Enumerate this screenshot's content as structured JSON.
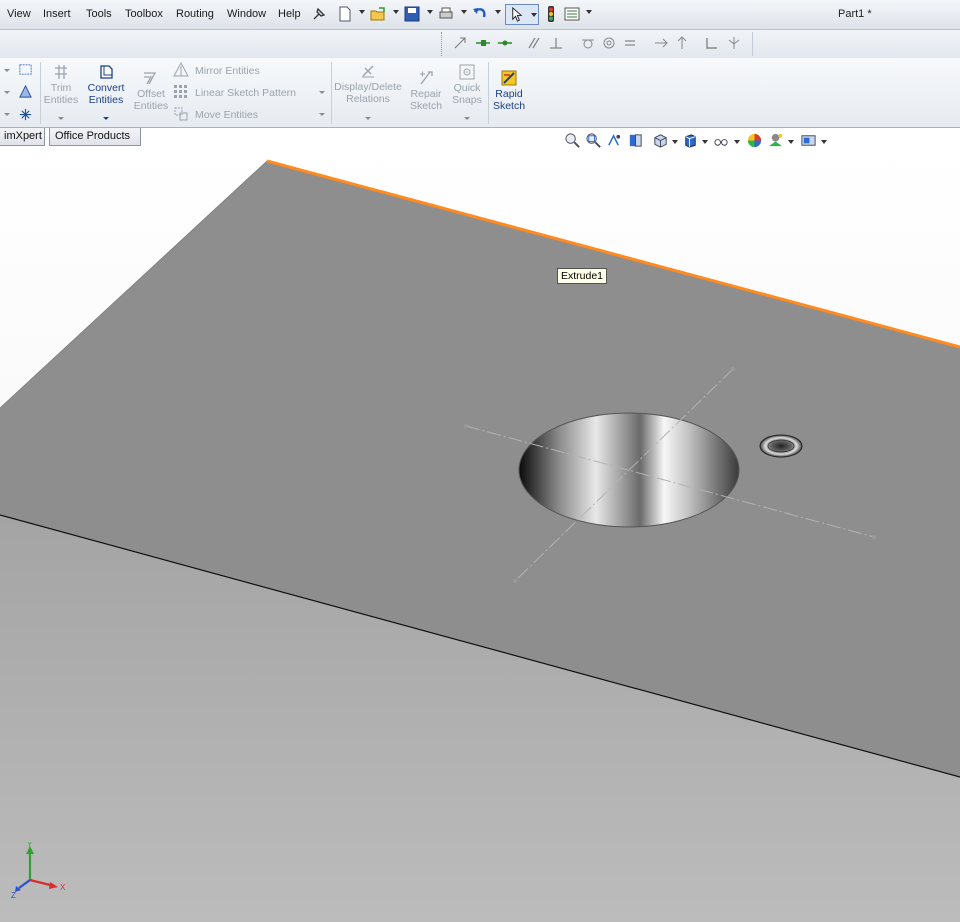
{
  "menu": {
    "items": [
      "View",
      "Insert",
      "Tools",
      "Toolbox",
      "Routing",
      "Window",
      "Help"
    ]
  },
  "document": {
    "title": "Part1 *"
  },
  "ribbon": {
    "trim": "Trim\nEntities",
    "convert": "Convert\nEntities",
    "offset": "Offset\nEntities",
    "mirror": "Mirror Entities",
    "linear_pattern": "Linear Sketch Pattern",
    "move": "Move Entities",
    "display_delete": "Display/Delete\nRelations",
    "repair": "Repair\nSketch",
    "quick_snaps": "Quick\nSnaps",
    "rapid_sketch": "Rapid\nSketch"
  },
  "tabs": [
    "imXpert",
    "Office Products"
  ],
  "viewport": {
    "tooltip": "Extrude1"
  },
  "triad": {
    "x": "X",
    "y": "Y",
    "z": "Z"
  },
  "colors": {
    "selected_edge": "#ff8a1f",
    "face": "#8e8e8e",
    "side": "#aaaaaa"
  },
  "icons": {
    "quick_access": [
      "new-document-icon",
      "open-folder-icon",
      "save-icon",
      "print-icon",
      "undo-icon",
      "select-arrow-icon",
      "rebuild-traffic-light-icon",
      "options-icon"
    ],
    "view_heads_up": [
      "zoom-to-fit-icon",
      "zoom-to-area-icon",
      "previous-view-icon",
      "section-view-icon",
      "view-orientation-icon",
      "display-style-icon",
      "hide-show-items-icon",
      "edit-appearance-icon",
      "apply-scene-icon",
      "view-settings-icon"
    ]
  }
}
